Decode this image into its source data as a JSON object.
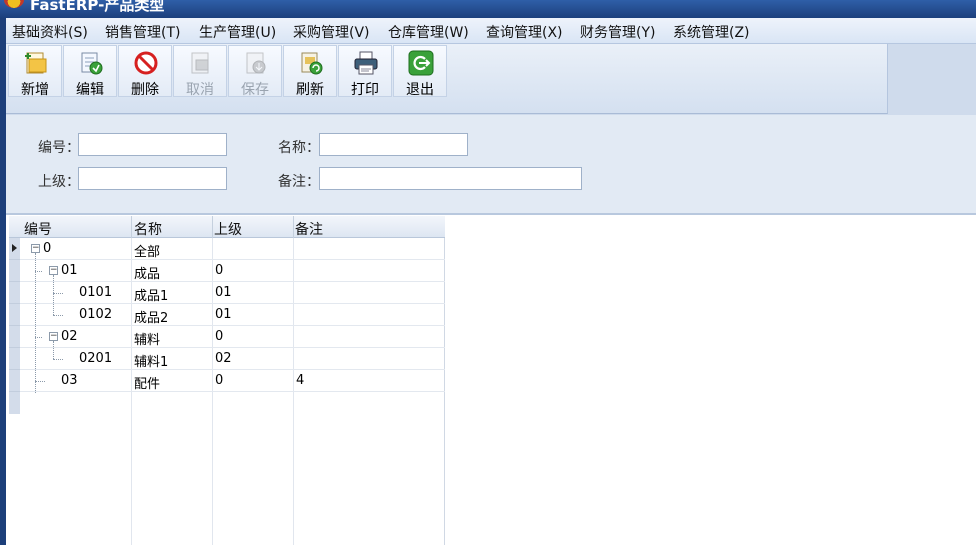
{
  "window": {
    "title": "FastERP-产品类型"
  },
  "menu": [
    "基础资料(S)",
    "销售管理(T)",
    "生产管理(U)",
    "采购管理(V)",
    "仓库管理(W)",
    "查询管理(X)",
    "财务管理(Y)",
    "系统管理(Z)"
  ],
  "toolbar": {
    "add": "新增",
    "edit": "编辑",
    "delete": "删除",
    "cancel": "取消",
    "save": "保存",
    "refresh": "刷新",
    "print": "打印",
    "exit": "退出"
  },
  "form": {
    "code_label": "编号：",
    "code_value": "",
    "name_label": "名称：",
    "name_value": "",
    "parent_label": "上级：",
    "parent_value": "",
    "remark_label": "备注：",
    "remark_value": ""
  },
  "grid": {
    "columns": [
      "编号",
      "名称",
      "上级",
      "备注"
    ],
    "rows": [
      {
        "code": "0",
        "name": "全部",
        "parent": "",
        "remark": ""
      },
      {
        "code": "01",
        "name": "成品",
        "parent": "0",
        "remark": ""
      },
      {
        "code": "0101",
        "name": "成品1",
        "parent": "01",
        "remark": ""
      },
      {
        "code": "0102",
        "name": "成品2",
        "parent": "01",
        "remark": ""
      },
      {
        "code": "02",
        "name": "辅料",
        "parent": "0",
        "remark": ""
      },
      {
        "code": "0201",
        "name": "辅料1",
        "parent": "02",
        "remark": ""
      },
      {
        "code": "03",
        "name": "配件",
        "parent": "0",
        "remark": "4"
      }
    ]
  },
  "icons": {
    "add": "new-doc-icon",
    "edit": "edit-doc-icon",
    "delete": "no-entry-icon",
    "cancel": "cancel-doc-icon",
    "save": "save-doc-icon",
    "refresh": "refresh-doc-icon",
    "print": "printer-icon",
    "exit": "exit-icon"
  },
  "colors": {
    "titlebar": "#1c3f7c",
    "delete": "#d62020",
    "exit": "#3aa13a"
  }
}
